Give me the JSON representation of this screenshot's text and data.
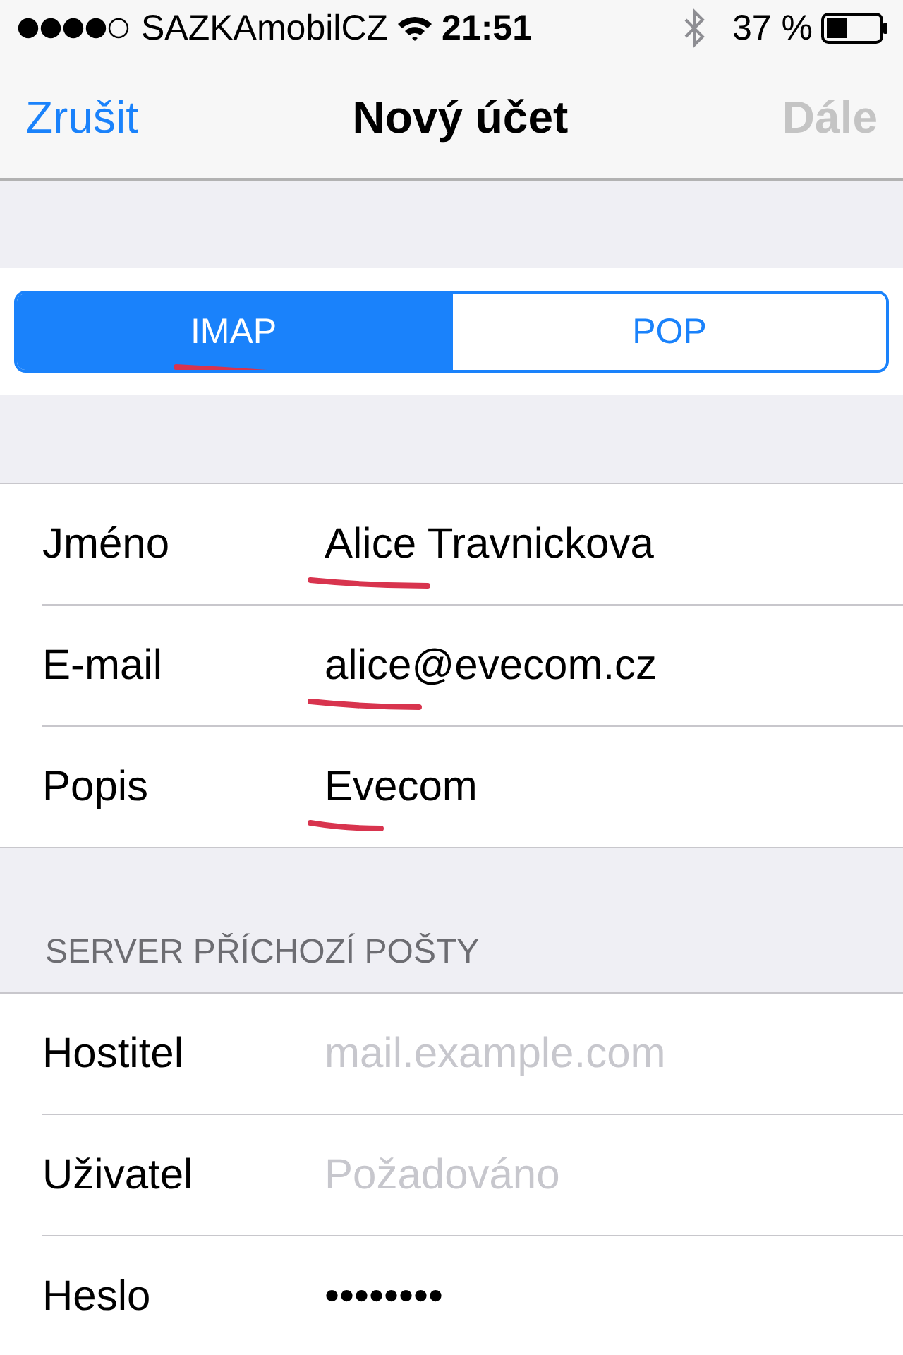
{
  "status_bar": {
    "carrier": "SAZKAmobilCZ",
    "time": "21:51",
    "battery": "37 %"
  },
  "nav": {
    "cancel": "Zrušit",
    "title": "Nový účet",
    "next": "Dále",
    "next_disabled": true
  },
  "segments": [
    {
      "label": "IMAP",
      "selected": true,
      "underlined": true
    },
    {
      "label": "POP",
      "selected": false,
      "underlined": false
    }
  ],
  "account_fields": [
    {
      "label": "Jméno",
      "value": "Alice Travnickova",
      "underlined": true
    },
    {
      "label": "E-mail",
      "value": "alice@evecom.cz",
      "underlined": true
    },
    {
      "label": "Popis",
      "value": "Evecom",
      "underlined": true
    }
  ],
  "incoming_server": {
    "header": "SERVER PŘÍCHOZÍ POŠTY",
    "fields": [
      {
        "label": "Hostitel",
        "placeholder": "mail.example.com"
      },
      {
        "label": "Uživatel",
        "placeholder": "Požadováno"
      },
      {
        "label": "Heslo",
        "value": "••••••••"
      }
    ]
  }
}
